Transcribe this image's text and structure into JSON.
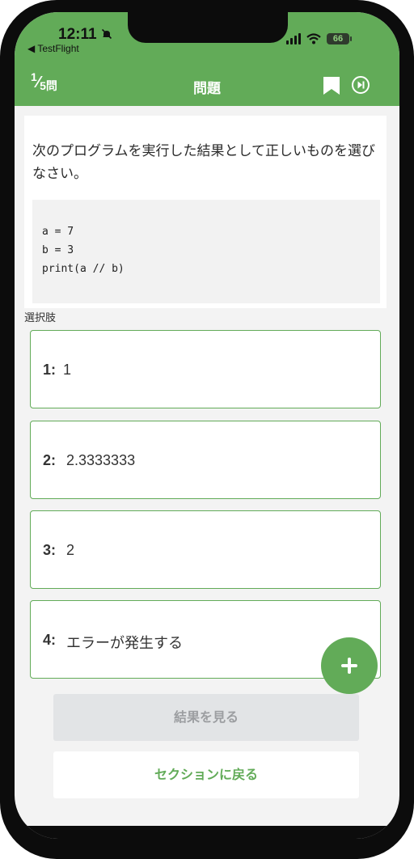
{
  "status_bar": {
    "time": "12:11",
    "back_app": "◀ TestFlight",
    "battery": "66"
  },
  "header": {
    "current": "1",
    "slash": "⁄",
    "total": "5問",
    "title": "問題"
  },
  "question": {
    "text": "次のプログラムを実行した結果として正しいものを選びなさい。",
    "code_lines": [
      "a = 7",
      "b = 3",
      "print(a // b)"
    ]
  },
  "choices_label": "選択肢",
  "choices": [
    {
      "num": "1:",
      "text": "1"
    },
    {
      "num": "2:",
      "text": "2.3333333"
    },
    {
      "num": "3:",
      "text": "2"
    },
    {
      "num": "4:",
      "text": "エラーが発生する"
    }
  ],
  "buttons": {
    "result": "結果を見る",
    "back": "セクションに戻る"
  },
  "colors": {
    "accent": "#62ab58",
    "disabled_bg": "#e2e4e6"
  },
  "icons": [
    "bell-slash-icon",
    "signal-icon",
    "wifi-icon",
    "bookmark-icon",
    "skip-icon",
    "plus-icon"
  ]
}
